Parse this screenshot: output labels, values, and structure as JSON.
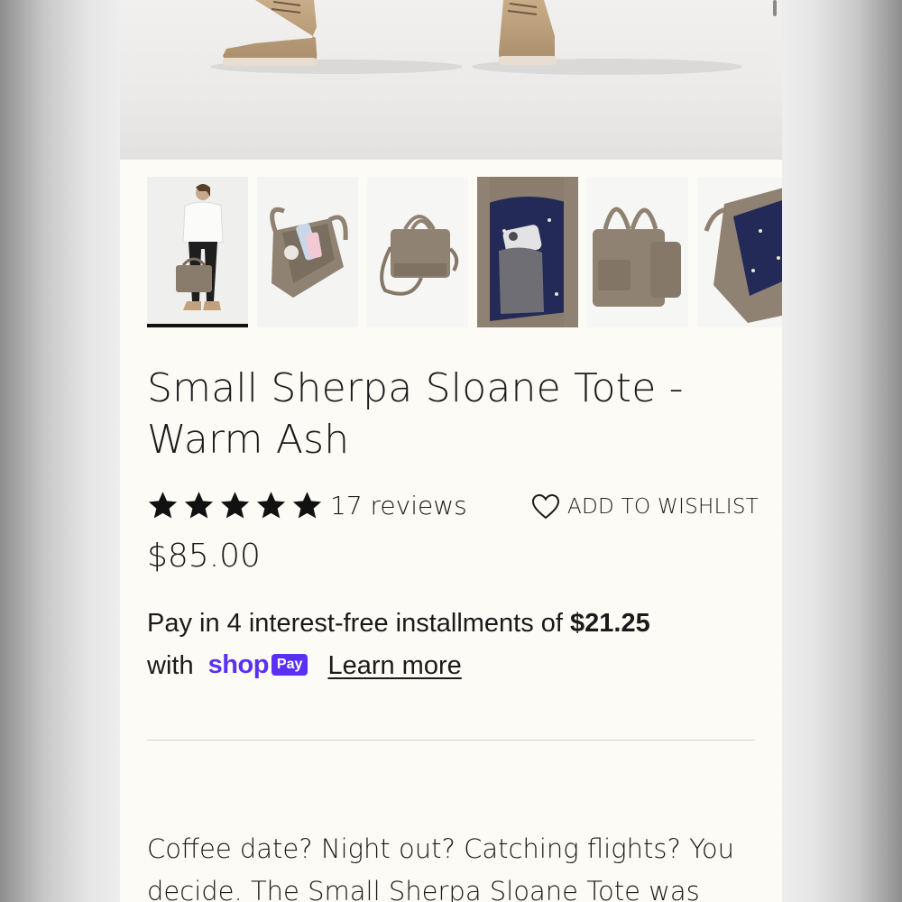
{
  "product": {
    "title": "Small Sherpa Sloane Tote - Warm Ash",
    "rating": 5,
    "reviews_label": "17 reviews",
    "price": "$85.00",
    "wishlist_label": "ADD TO WISHLIST"
  },
  "installments": {
    "prefix": "Pay in 4 interest-free installments of ",
    "amount": "$21.25",
    "with": "with",
    "shop_word": "shop",
    "pay_word": "Pay",
    "learn_more": "Learn more"
  },
  "description": {
    "text": "Coffee date? Night out? Catching flights? You decide. The Small Sherpa Sloane Tote was"
  },
  "gallery": {
    "selected_index": 0,
    "thumbnails": [
      "model-holding-tote",
      "tote-open-contents",
      "tote-with-strap",
      "tote-interior-pocket",
      "tote-side-view",
      "tote-angled-lining"
    ]
  },
  "colors": {
    "page_bg": "#fdfbf5",
    "text": "#1a1a1a",
    "shop_pay": "#5a31f4",
    "sherpa": "#8f8272"
  }
}
